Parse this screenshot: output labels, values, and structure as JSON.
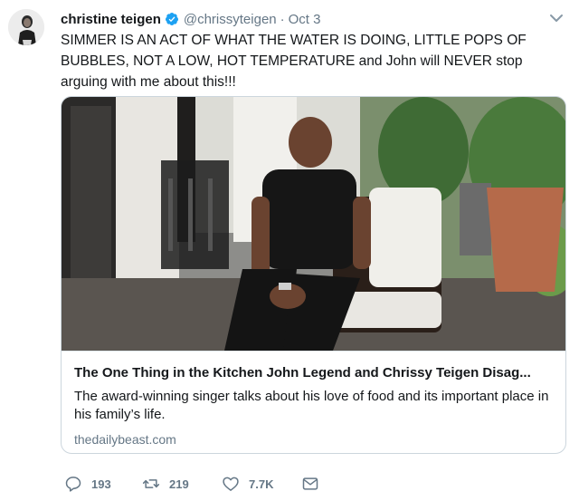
{
  "tweet": {
    "author": {
      "display_name": "christine teigen",
      "handle": "@chrissyteigen",
      "verified": true,
      "verified_color": "#1da1f2"
    },
    "separator": "·",
    "date": "Oct 3",
    "text": "SIMMER IS AN ACT OF WHAT THE WATER IS DOING, LITTLE POPS OF BUBBLES, NOT A LOW, HOT TEMPERATURE and John will NEVER stop arguing with me about this!!!",
    "card": {
      "image_icon": "photo",
      "title": "The One Thing in the Kitchen John Legend and Chrissy Teigen Disag...",
      "description": "The award-winning singer talks about his love of food and its important place in his family’s life.",
      "domain": "thedailybeast.com"
    },
    "actions": {
      "reply": {
        "icon": "reply-icon",
        "count": "193"
      },
      "retweet": {
        "icon": "retweet-icon",
        "count": "219"
      },
      "like": {
        "icon": "heart-icon",
        "count": "7.7K"
      },
      "dm": {
        "icon": "envelope-icon"
      }
    },
    "colors": {
      "text": "#14171a",
      "muted": "#657786",
      "border": "#ccd6dd"
    }
  }
}
